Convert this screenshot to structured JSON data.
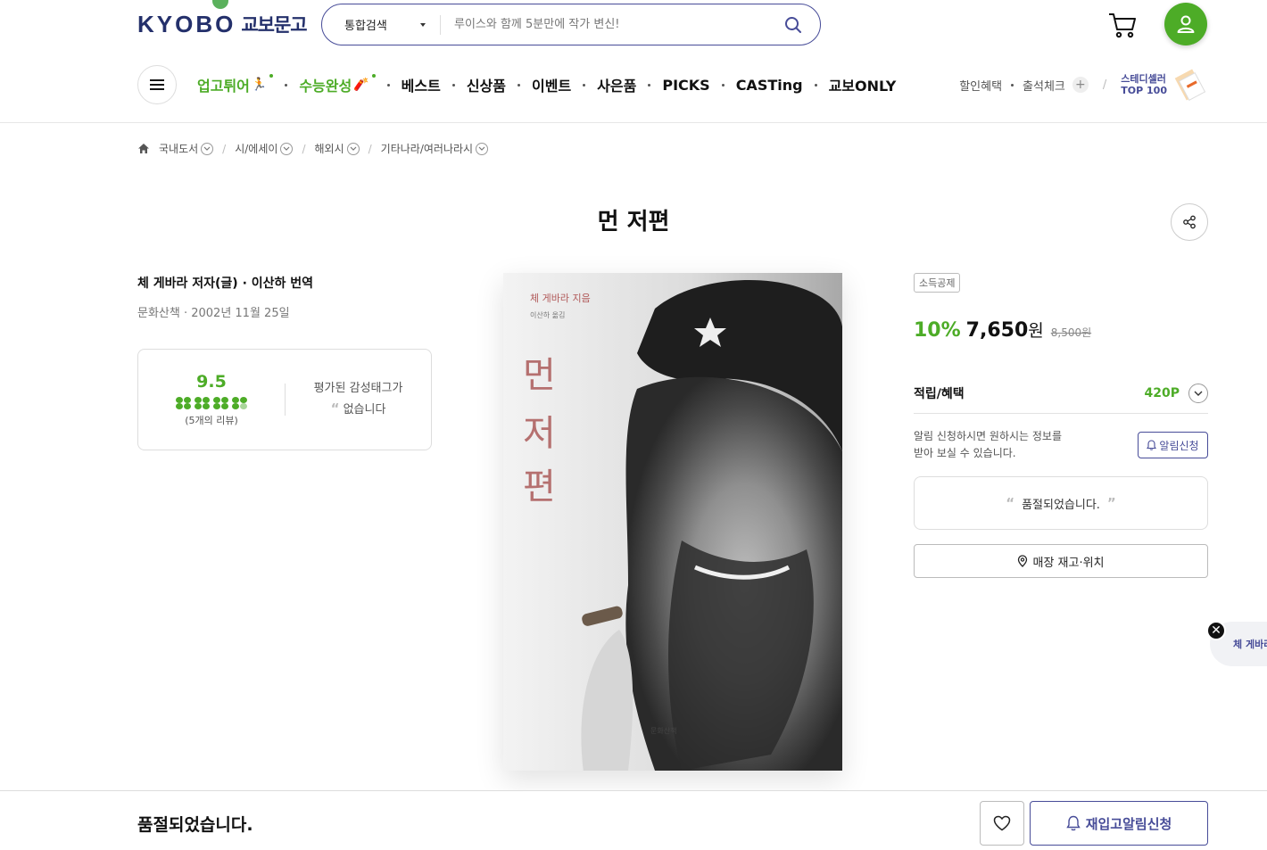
{
  "brand": {
    "en": "KYOBO",
    "kr": "교보문고"
  },
  "search": {
    "scope": "통합검색",
    "placeholder": "루이스와 함께 5분만에 작가 변신!"
  },
  "gnb": {
    "items": [
      {
        "label": "업고튀어",
        "emoji": "🏃",
        "green": true,
        "dot": true
      },
      {
        "label": "수능완성",
        "emoji": "🧨",
        "green": true,
        "dot": true
      },
      {
        "label": "베스트"
      },
      {
        "label": "신상품"
      },
      {
        "label": "이벤트"
      },
      {
        "label": "사은품"
      },
      {
        "label": "PICKS"
      },
      {
        "label": "CASTing"
      },
      {
        "label": "교보ONLY"
      }
    ],
    "right": {
      "discount": "할인혜택",
      "checkin": "출석체크",
      "steady_line1": "스테디셀러",
      "steady_line2": "TOP 100"
    }
  },
  "breadcrumb": [
    "국내도서",
    "시/에세이",
    "해외시",
    "기타나라/여러나라시"
  ],
  "book": {
    "title": "먼 저편",
    "author_line": "체 게바라 저자(글) · 이산하 번역",
    "publisher_line": "문화산책 · 2002년 11월 25일",
    "rating": "9.5",
    "review_count": "(5개의 리뷰)",
    "emotion_line1": "평가된 감성태그가",
    "emotion_line2": "없습니다",
    "cover": {
      "author_ko": "체 게바라 지음",
      "translator": "이산하 옮김",
      "title_chars": [
        "먼",
        "저",
        "편"
      ],
      "publisher": "문화산책"
    }
  },
  "purchase": {
    "tag": "소득공제",
    "discount": "10%",
    "price": "7,650",
    "won": "원",
    "original_price": "8,500원",
    "benefit_label": "적립/혜택",
    "points": "420P",
    "notify_line1": "알림 신청하시면 원하시는 정보를",
    "notify_line2": "받아 보실 수 있습니다.",
    "notify_btn": "알림신청",
    "soldout": "품절되었습니다.",
    "store_btn": "매장 재고·위치"
  },
  "float_author": "체 게바라",
  "bottom": {
    "message": "품절되었습니다.",
    "restock_btn": "재입고알림신청"
  },
  "colors": {
    "green": "#4dac27",
    "navy": "#474c98",
    "brand": "#24306b"
  }
}
